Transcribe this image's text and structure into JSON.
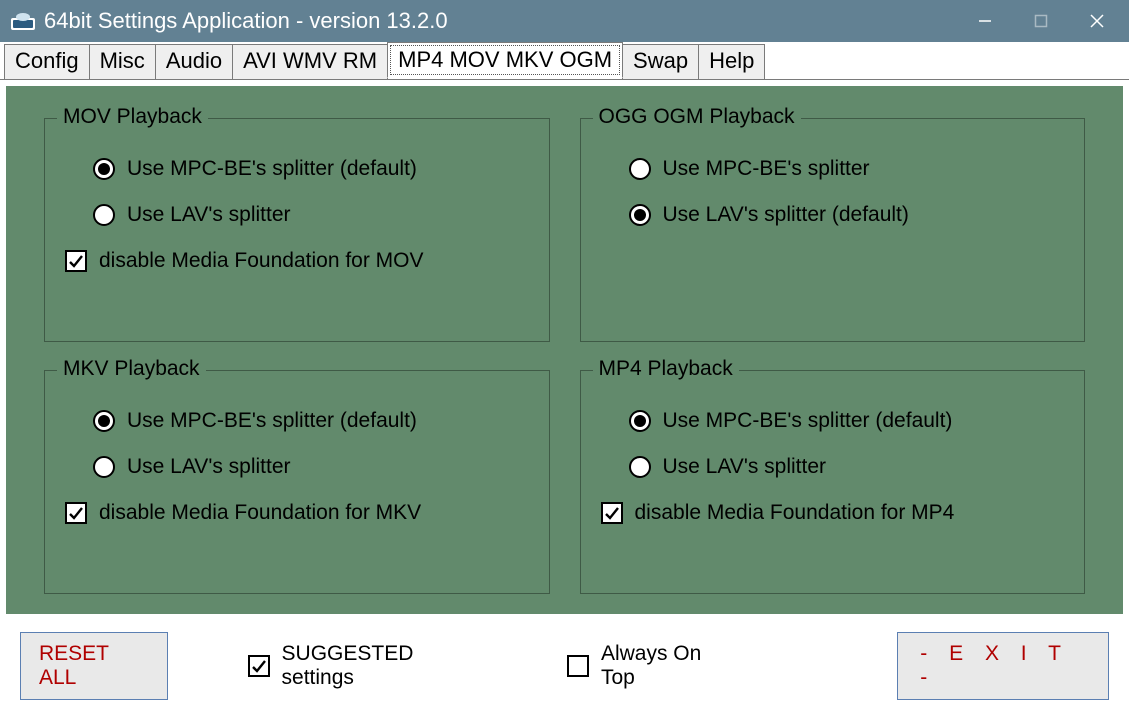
{
  "window": {
    "title": "64bit Settings Application - version 13.2.0"
  },
  "tabs": {
    "config": "Config",
    "misc": "Misc",
    "audio": "Audio",
    "avi": "AVI WMV RM",
    "mp4": "MP4 MOV MKV OGM",
    "swap": "Swap",
    "help": "Help",
    "active": "mp4"
  },
  "groups": {
    "mov": {
      "title": "MOV Playback",
      "opt1": "Use MPC-BE's splitter (default)",
      "opt2": "Use LAV's splitter",
      "disable": "disable Media Foundation for MOV",
      "selected": 1,
      "disable_checked": true
    },
    "ogg": {
      "title": "OGG OGM Playback",
      "opt1": "Use MPC-BE's splitter",
      "opt2": "Use LAV's splitter (default)",
      "selected": 2
    },
    "mkv": {
      "title": "MKV Playback",
      "opt1": "Use MPC-BE's splitter (default)",
      "opt2": "Use LAV's splitter",
      "disable": "disable Media Foundation for MKV",
      "selected": 1,
      "disable_checked": true
    },
    "mp4": {
      "title": "MP4 Playback",
      "opt1": "Use MPC-BE's splitter (default)",
      "opt2": "Use LAV's splitter",
      "disable": "disable Media Foundation for MP4",
      "selected": 1,
      "disable_checked": true
    }
  },
  "footer": {
    "reset": "RESET ALL",
    "suggested": "SUGGESTED settings",
    "suggested_checked": true,
    "always_on_top": "Always On Top",
    "always_on_top_checked": false,
    "exit": "-  E X I T  -"
  }
}
